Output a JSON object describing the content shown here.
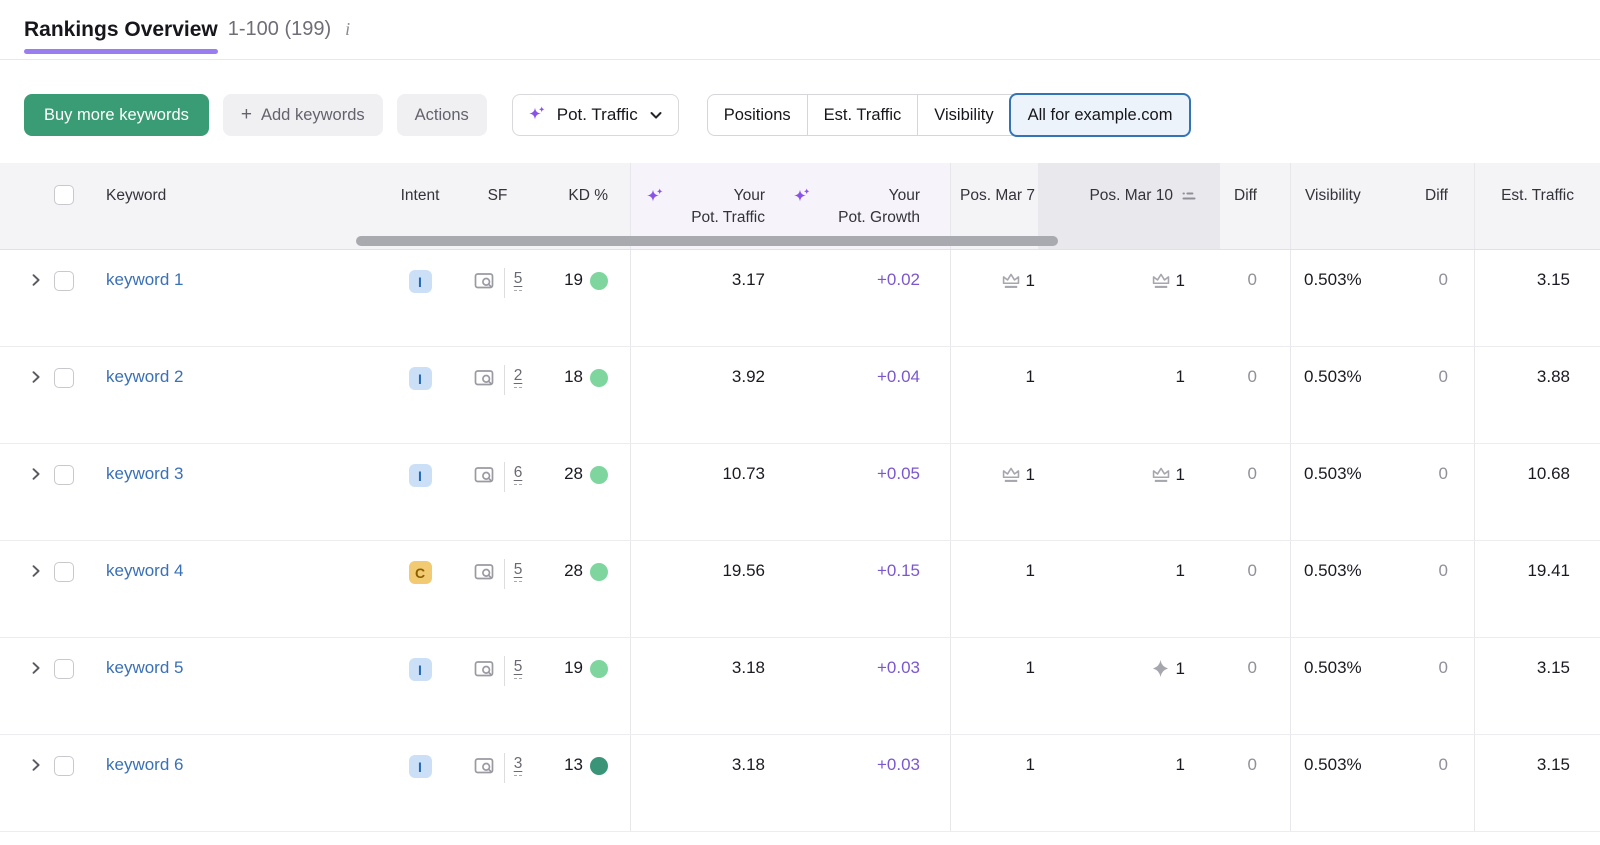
{
  "page": {
    "title": "Rankings Overview",
    "range": "1-100 (199)",
    "info_icon": "info-icon"
  },
  "toolbar": {
    "buy_label": "Buy more keywords",
    "add_plus": "+",
    "add_label": "Add keywords",
    "actions_label": "Actions",
    "metric_selector": {
      "icon": "ai-sparkle-icon",
      "label": "Pot. Traffic",
      "chevron": "chevron-down-icon"
    },
    "tabs": [
      {
        "label": "Positions",
        "selected": false
      },
      {
        "label": "Est. Traffic",
        "selected": false
      },
      {
        "label": "Visibility",
        "selected": false
      },
      {
        "label": "All for example.com",
        "selected": true
      }
    ]
  },
  "table": {
    "headers": {
      "keyword": "Keyword",
      "intent": "Intent",
      "sf": "SF",
      "kd": "KD %",
      "pot_traffic_l1": "Your",
      "pot_traffic_l2": "Pot. Traffic",
      "pot_growth_l1": "Your",
      "pot_growth_l2": "Pot. Growth",
      "pos_mar7": "Pos. Mar 7",
      "pos_mar10": "Pos. Mar 10",
      "diff1": "Diff",
      "visibility": "Visibility",
      "diff2": "Diff",
      "est_traffic": "Est. Traffic",
      "sorted_column": "Pos. Mar 10",
      "ai_column_icon": "ai-sparkle-icon",
      "sort_icon": "sort-icon"
    },
    "rows": [
      {
        "keyword": "keyword 1",
        "intent": "I",
        "sf": "5",
        "kd": "19",
        "kd_level": "easy",
        "pot_traffic": "3.17",
        "pot_growth": "+0.02",
        "pos_mar7": "1",
        "pos_mar7_icon": "crown-icon",
        "pos_mar10": "1",
        "pos_mar10_icon": "crown-icon",
        "diff1": "0",
        "visibility": "0.503%",
        "diff2": "0",
        "est_traffic": "3.15"
      },
      {
        "keyword": "keyword 2",
        "intent": "I",
        "sf": "2",
        "kd": "18",
        "kd_level": "easy",
        "pot_traffic": "3.92",
        "pot_growth": "+0.04",
        "pos_mar7": "1",
        "pos_mar7_icon": "none",
        "pos_mar10": "1",
        "pos_mar10_icon": "none",
        "diff1": "0",
        "visibility": "0.503%",
        "diff2": "0",
        "est_traffic": "3.88"
      },
      {
        "keyword": "keyword 3",
        "intent": "I",
        "sf": "6",
        "kd": "28",
        "kd_level": "easy",
        "pot_traffic": "10.73",
        "pot_growth": "+0.05",
        "pos_mar7": "1",
        "pos_mar7_icon": "crown-icon",
        "pos_mar10": "1",
        "pos_mar10_icon": "crown-icon",
        "diff1": "0",
        "visibility": "0.503%",
        "diff2": "0",
        "est_traffic": "10.68"
      },
      {
        "keyword": "keyword 4",
        "intent": "C",
        "sf": "5",
        "kd": "28",
        "kd_level": "easy",
        "pot_traffic": "19.56",
        "pot_growth": "+0.15",
        "pos_mar7": "1",
        "pos_mar7_icon": "none",
        "pos_mar10": "1",
        "pos_mar10_icon": "none",
        "diff1": "0",
        "visibility": "0.503%",
        "diff2": "0",
        "est_traffic": "19.41"
      },
      {
        "keyword": "keyword 5",
        "intent": "I",
        "sf": "5",
        "kd": "19",
        "kd_level": "easy",
        "pot_traffic": "3.18",
        "pot_growth": "+0.03",
        "pos_mar7": "1",
        "pos_mar7_icon": "none",
        "pos_mar10": "1",
        "pos_mar10_icon": "ai-overview-icon",
        "diff1": "0",
        "visibility": "0.503%",
        "diff2": "0",
        "est_traffic": "3.15"
      },
      {
        "keyword": "keyword 6",
        "intent": "I",
        "sf": "3",
        "kd": "13",
        "kd_level": "very-easy",
        "pot_traffic": "3.18",
        "pot_growth": "+0.03",
        "pos_mar7": "1",
        "pos_mar7_icon": "none",
        "pos_mar10": "1",
        "pos_mar10_icon": "none",
        "diff1": "0",
        "visibility": "0.503%",
        "diff2": "0",
        "est_traffic": "3.15"
      }
    ]
  },
  "colors": {
    "accent-purple": "#9b7df2",
    "brand-green": "#3a9c74",
    "tab-selected-blue": "#3474b6",
    "tab-selected-bg": "#ecf3fa",
    "link-blue": "#3a70b6",
    "growth-purple": "#7b57cf",
    "sparkle-purple": "#8b52e8",
    "ai-col-bg": "#f7f3fb",
    "kd-easy": "#7ed69e",
    "kd-very-easy": "#3a9478",
    "intent-info-bg": "#cbe0f7",
    "intent-info-text": "#2268b5",
    "intent-commercial-bg": "#f2ca72",
    "intent-commercial-text": "#8a5f00"
  }
}
